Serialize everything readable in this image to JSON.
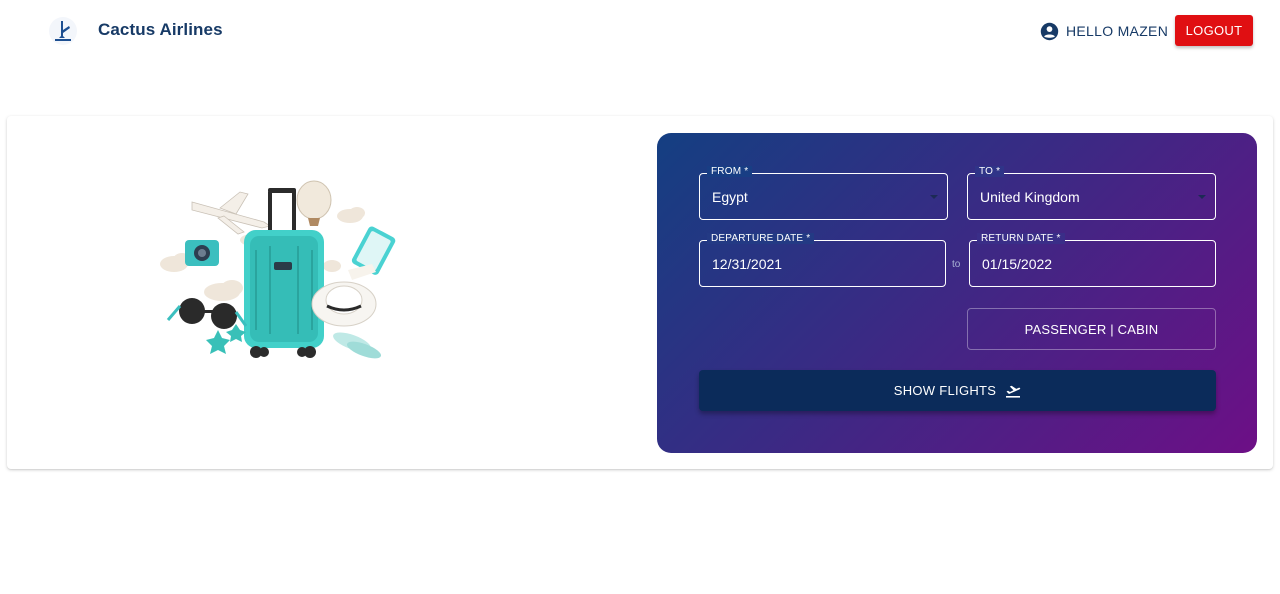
{
  "header": {
    "brand_name": "Cactus Airlines",
    "logo_icon": "plane-landing-logo-icon",
    "user_icon": "account-circle-icon",
    "greeting": "HELLO MAZEN",
    "logout_label": "LOGOUT"
  },
  "search": {
    "from": {
      "label": "FROM *",
      "value": "Egypt"
    },
    "to": {
      "label": "TO *",
      "value": "United Kingdom"
    },
    "departure": {
      "label": "DEPARTURE DATE *",
      "value": "12/31/2021"
    },
    "range_separator": "to",
    "return": {
      "label": "RETURN DATE *",
      "value": "01/15/2022"
    },
    "passenger_cabin_label": "PASSENGER | CABIN",
    "show_flights_label": "SHOW FLIGHTS",
    "show_flights_icon": "flight-takeoff-icon"
  },
  "colors": {
    "brand_text": "#173a66",
    "logout_bg": "#e00f12",
    "panel_gradient_start": "#143f82",
    "panel_gradient_end": "#6d0f86",
    "show_flights_bg": "#0b2b5a"
  }
}
